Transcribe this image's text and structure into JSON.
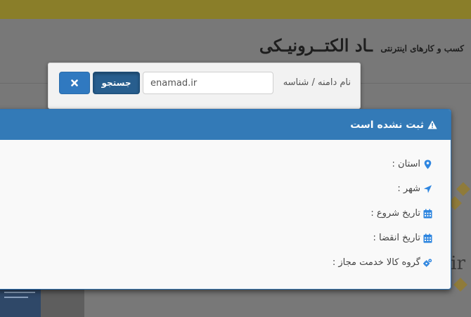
{
  "site": {
    "title_main": "ـاد الکتــرونیـکی",
    "title_sub": "کسب و کارهای اینترنتی",
    "background_text": "ir"
  },
  "search": {
    "label": "نام دامنه / شناسه",
    "input_value": "enamad.ir",
    "search_button": "جستجو",
    "close_icon": "close-icon"
  },
  "result": {
    "status": "ثبت نشده است",
    "status_icon": "warning-icon",
    "fields": [
      {
        "label": "استان :",
        "icon": "map-marker-icon"
      },
      {
        "label": "شهر :",
        "icon": "location-arrow-icon"
      },
      {
        "label": "تاریخ شروع :",
        "icon": "calendar-icon"
      },
      {
        "label": "تاریخ انقضا :",
        "icon": "calendar-icon"
      },
      {
        "label": "گروه کالا خدمت مجاز :",
        "icon": "cogs-icon"
      }
    ]
  },
  "colors": {
    "primary": "#337ab7",
    "active_button": "#285e8e",
    "icon_blue": "#2f86e0",
    "top_banner": "#8a7e29"
  }
}
